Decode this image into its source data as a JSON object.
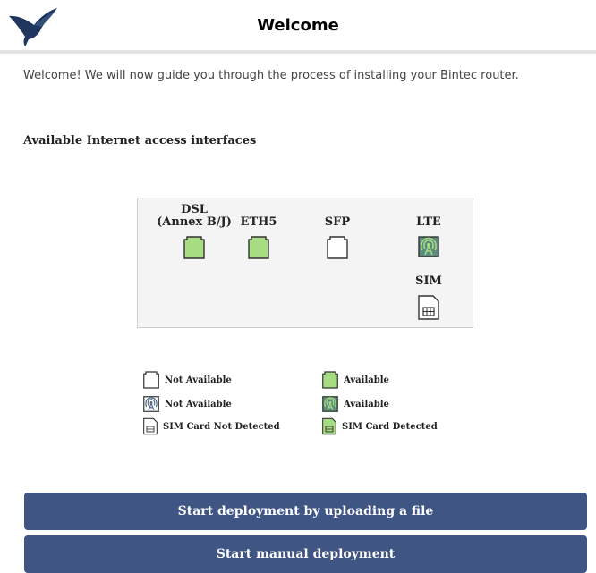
{
  "header": {
    "title": "Welcome",
    "logo": "hummingbird-logo"
  },
  "intro_text": "Welcome! We will now guide you through the process of installing your Bintec router.",
  "section_title": "Available Internet access interfaces",
  "interfaces": [
    {
      "name": "DSL",
      "sub": "(Annex B/J)",
      "status": "available",
      "icon": "port-icon"
    },
    {
      "name": "ETH5",
      "status": "available",
      "icon": "port-icon"
    },
    {
      "name": "SFP",
      "status": "not-available",
      "icon": "port-icon"
    },
    {
      "name": "LTE",
      "status": "available",
      "icon": "antenna-icon"
    },
    {
      "name": "SIM",
      "status": "sim-not-detected",
      "icon": "sim-card-icon"
    }
  ],
  "legend": [
    {
      "label": "Not Available",
      "icon": "port-icon",
      "state": "not-available"
    },
    {
      "label": "Available",
      "icon": "port-icon",
      "state": "available"
    },
    {
      "label": "Not Available",
      "icon": "antenna-icon",
      "state": "not-available"
    },
    {
      "label": "Available",
      "icon": "antenna-icon",
      "state": "available"
    },
    {
      "label": "SIM Card Not Detected",
      "icon": "sim-card-icon",
      "state": "not-detected"
    },
    {
      "label": "SIM Card Detected",
      "icon": "sim-card-icon",
      "state": "detected"
    }
  ],
  "buttons": {
    "upload": "Start deployment by uploading a file",
    "manual": "Start manual deployment"
  },
  "colors": {
    "available": "#a6dd82",
    "button": "#3f5584",
    "antenna_bg": "#5d8a7e"
  }
}
